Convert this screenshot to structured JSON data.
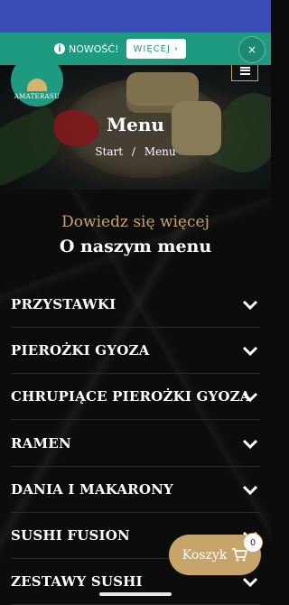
{
  "notice": {
    "info_icon": "i",
    "text": "NOWOŚĆ!",
    "button_label": "WIĘCEJ",
    "button_arrow": "›",
    "close_glyph": "×"
  },
  "header": {
    "logo_text": "AMATERASU",
    "page_title": "Menu",
    "breadcrumb": {
      "start": "Start",
      "separator": "/",
      "current": "Menu"
    }
  },
  "section": {
    "subtitle": "Dowiedz się więcej",
    "title": "O naszym menu",
    "items": [
      {
        "label": "PRZYSTAWKI"
      },
      {
        "label": "PIEROŻKI GYOZA"
      },
      {
        "label": "CHRUPIĄCE PIEROŻKI GYOZA"
      },
      {
        "label": "RAMEN"
      },
      {
        "label": "DANIA I MAKARONY"
      },
      {
        "label": "SUSHI FUSION"
      },
      {
        "label": "ZESTAWY SUSHI"
      }
    ]
  },
  "cart": {
    "label": "Koszyk",
    "count": "0"
  },
  "colors": {
    "accent_gold": "#c6a46a",
    "notice_green": "#1d9a80",
    "status_blue": "#3b4db8"
  }
}
